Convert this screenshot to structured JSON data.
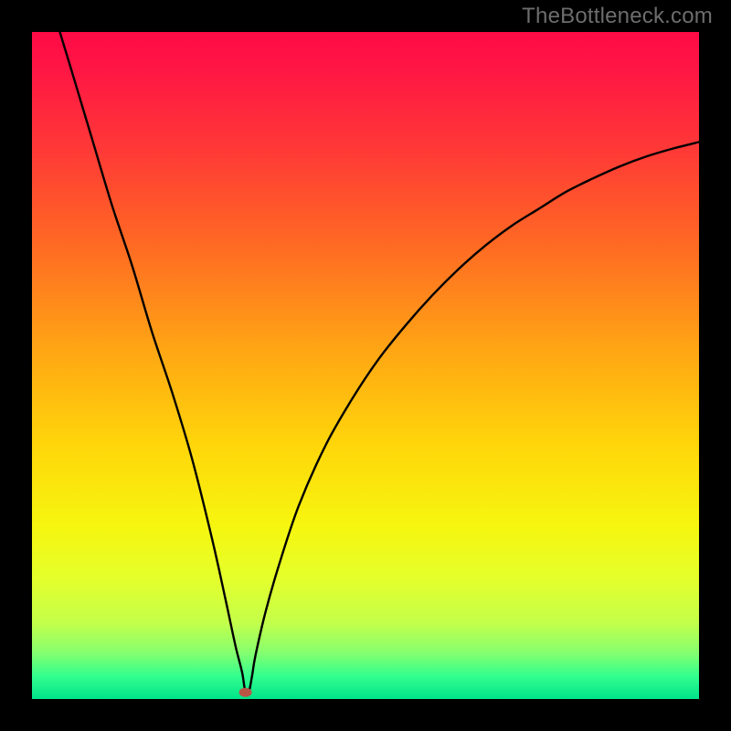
{
  "watermark": "TheBottleneck.com",
  "colors": {
    "gradient_stops": [
      {
        "offset": 0.0,
        "color": "#ff0a46"
      },
      {
        "offset": 0.06,
        "color": "#ff1744"
      },
      {
        "offset": 0.18,
        "color": "#ff3a36"
      },
      {
        "offset": 0.32,
        "color": "#ff6a23"
      },
      {
        "offset": 0.48,
        "color": "#ffa714"
      },
      {
        "offset": 0.62,
        "color": "#ffd60a"
      },
      {
        "offset": 0.74,
        "color": "#f6f60f"
      },
      {
        "offset": 0.82,
        "color": "#e4ff2b"
      },
      {
        "offset": 0.885,
        "color": "#c4ff4a"
      },
      {
        "offset": 0.93,
        "color": "#86ff6e"
      },
      {
        "offset": 0.965,
        "color": "#34ff8e"
      },
      {
        "offset": 1.0,
        "color": "#00e38a"
      }
    ],
    "curve": "#000000",
    "marker": "#b85545",
    "background": "#000000"
  },
  "chart_data": {
    "type": "line",
    "title": "",
    "xlabel": "",
    "ylabel": "",
    "xlim": [
      0,
      100
    ],
    "ylim": [
      0,
      100
    ],
    "grid": false,
    "legend": false,
    "marker": {
      "x": 32,
      "y": 1,
      "color": "#b85545"
    },
    "series": [
      {
        "name": "bottleneck-curve",
        "x": [
          0,
          3,
          6,
          9,
          12,
          15,
          18,
          21,
          24,
          27,
          29,
          30.5,
          31.5,
          32,
          32.5,
          33,
          33.5,
          35,
          37,
          40,
          44,
          48,
          52,
          56,
          60,
          64,
          68,
          72,
          76,
          80,
          84,
          88,
          92,
          96,
          100
        ],
        "y": [
          115,
          104,
          94,
          84,
          74,
          65,
          55,
          46,
          36,
          24,
          15,
          8,
          4,
          1,
          1,
          3.5,
          6.5,
          13,
          20,
          29,
          38,
          45,
          51,
          56,
          60.5,
          64.5,
          68,
          71,
          73.5,
          76,
          78,
          79.8,
          81.3,
          82.5,
          83.5
        ]
      }
    ]
  }
}
